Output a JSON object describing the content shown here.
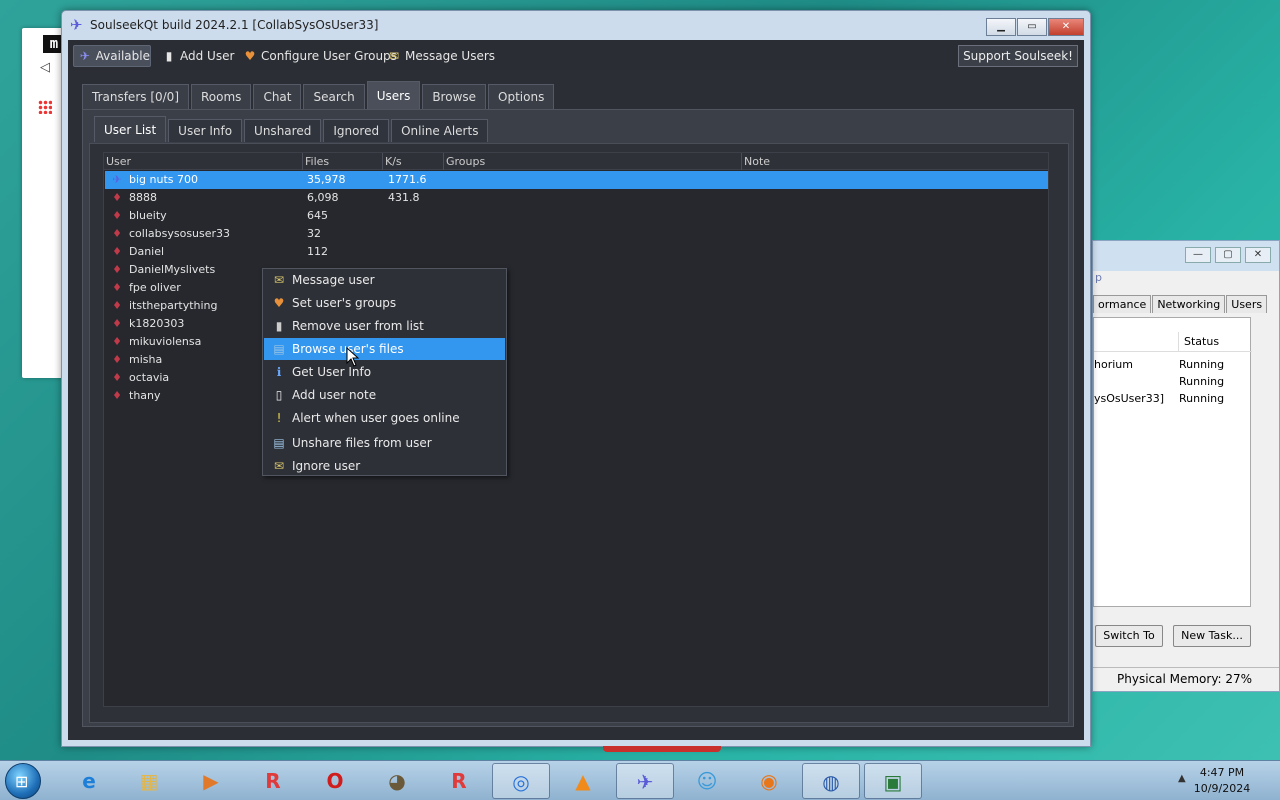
{
  "background_browser": {
    "logo_text": "m"
  },
  "task_manager": {
    "menu_fragment": "p",
    "tabs": [
      "ormance",
      "Networking",
      "Users"
    ],
    "status_header": "Status",
    "rows": [
      {
        "name": "horium",
        "status": "Running"
      },
      {
        "name": "",
        "status": "Running"
      },
      {
        "name": "ysOsUser33]",
        "status": "Running"
      }
    ],
    "switch_to": "Switch To",
    "new_task": "New Task...",
    "physical_memory": "Physical Memory: 27%"
  },
  "window": {
    "title": "SoulseekQt build 2024.2.1 [CollabSysOsUser33]"
  },
  "toolbar": {
    "status": "Available",
    "add_user": "Add User",
    "configure_groups": "Configure User Groups",
    "message_users": "Message Users",
    "support": "Support Soulseek!"
  },
  "main_tabs": [
    "Transfers [0/0]",
    "Rooms",
    "Chat",
    "Search",
    "Users",
    "Browse",
    "Options"
  ],
  "active_main_tab": "Users",
  "sub_tabs": [
    "User List",
    "User Info",
    "Unshared",
    "Ignored",
    "Online Alerts"
  ],
  "active_sub_tab": "User List",
  "columns": [
    "User",
    "Files",
    "K/s",
    "Groups",
    "Note"
  ],
  "users": [
    {
      "name": "big nuts 700",
      "files": "35,978",
      "speed": "1771.6",
      "selected": true
    },
    {
      "name": "8888",
      "files": "6,098",
      "speed": "431.8"
    },
    {
      "name": "blueity",
      "files": "645",
      "speed": ""
    },
    {
      "name": "collabsysosuser33",
      "files": "32",
      "speed": ""
    },
    {
      "name": "Daniel",
      "files": "112",
      "speed": ""
    },
    {
      "name": "DanielMyslivets",
      "files": "",
      "speed": ""
    },
    {
      "name": "fpe oliver",
      "files": "",
      "speed": ""
    },
    {
      "name": "itsthepartything",
      "files": "",
      "speed": ""
    },
    {
      "name": "k1820303",
      "files": "",
      "speed": ""
    },
    {
      "name": "mikuviolensa",
      "files": "",
      "speed": ""
    },
    {
      "name": "misha",
      "files": "",
      "speed": ""
    },
    {
      "name": "octavia",
      "files": "",
      "speed": ""
    },
    {
      "name": "thany",
      "files": "",
      "speed": ""
    }
  ],
  "context_menu": [
    {
      "label": "Message user",
      "icon": "message-icon"
    },
    {
      "label": "Set user's groups",
      "icon": "groups-icon"
    },
    {
      "label": "Remove user from list",
      "icon": "remove-icon"
    },
    {
      "label": "Browse user's files",
      "icon": "browse-icon",
      "highlighted": true
    },
    {
      "label": "Get User Info",
      "icon": "info-icon"
    },
    {
      "label": "Add user note",
      "icon": "note-icon"
    },
    {
      "label": "Alert when user goes online",
      "icon": "alert-icon"
    },
    {
      "label": "Unshare files from user",
      "icon": "unshare-icon"
    },
    {
      "label": "Ignore user",
      "icon": "ignore-icon"
    }
  ],
  "taskbar": {
    "time": "4:47 PM",
    "date": "10/9/2024",
    "apps": [
      "internet-explorer-icon",
      "file-explorer-icon",
      "media-player-icon",
      "roblox-icon",
      "opera-icon",
      "gimp-icon",
      "roblox-studio-icon",
      "chrome-icon",
      "vlc-icon",
      "soulseek-icon",
      "messenger-icon",
      "firefox-icon",
      "network-icon",
      "task-manager-icon"
    ]
  },
  "colors": {
    "selection": "#3397f0",
    "user_icon": "#c03a4a",
    "window_bg": "#2b2e35"
  }
}
